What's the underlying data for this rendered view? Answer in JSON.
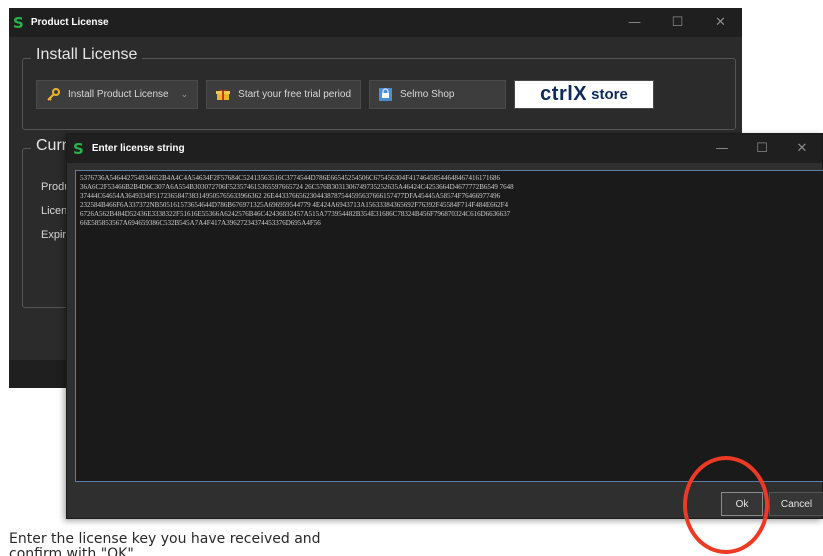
{
  "main_window": {
    "logo": "S",
    "title": "Product License",
    "controls": {
      "minimize": "—",
      "maximize": "☐",
      "close": "✕"
    },
    "install_group": {
      "title": "Install License",
      "buttons": {
        "install": "Install Product License",
        "trial": "Start your free trial period",
        "shop": "Selmo Shop",
        "store_brand": "ctrlX",
        "store_suffix": "store"
      }
    },
    "current_group": {
      "title": "Curr",
      "labels": [
        "Produ",
        "Licens",
        "Expira"
      ]
    }
  },
  "dialog": {
    "logo": "S",
    "title": "Enter license string",
    "controls": {
      "minimize": "—",
      "maximize": "☐",
      "close": "✕"
    },
    "license_lines": [
      "5376736A546442754934652B4A4C4A54634F2F57684C52413563516C3774544D786E66545254506C675456304F41746458544648467416171686",
      "36A6C2F53466B2B4D6C307A6A554B303072706F523574615365597665724 26C576B3031306749735252635A46424C4253664D4677772B6549 7648",
      "37444C64654A3649334F5172365847383149505765633966362 26E4433766562304438787544595637666157477DFA45445A58574F76466977496",
      "232584B466F6A337372NB505161573654644D786B676971325A696959544779 4E424A6943713A15633384365692F76392F45584F714F484E662F4",
      "6726A562B484D52436E3338322F51616E55366A6242576B46C42436832457A515A773954482B354E31686C78324B456F796870324C616D6636637",
      "66E585853567A694659386C532B545A7A4F417A39627234374453376D695A4F56"
    ],
    "ok_label": "Ok",
    "cancel_label": "Cancel"
  },
  "caption": {
    "line1": "Enter the license key you have received and",
    "line2": "confirm with \"OK\"."
  },
  "colors": {
    "accent_green": "#28b34a",
    "highlight_red": "#ee3a24",
    "input_border": "#5a7ea6"
  }
}
